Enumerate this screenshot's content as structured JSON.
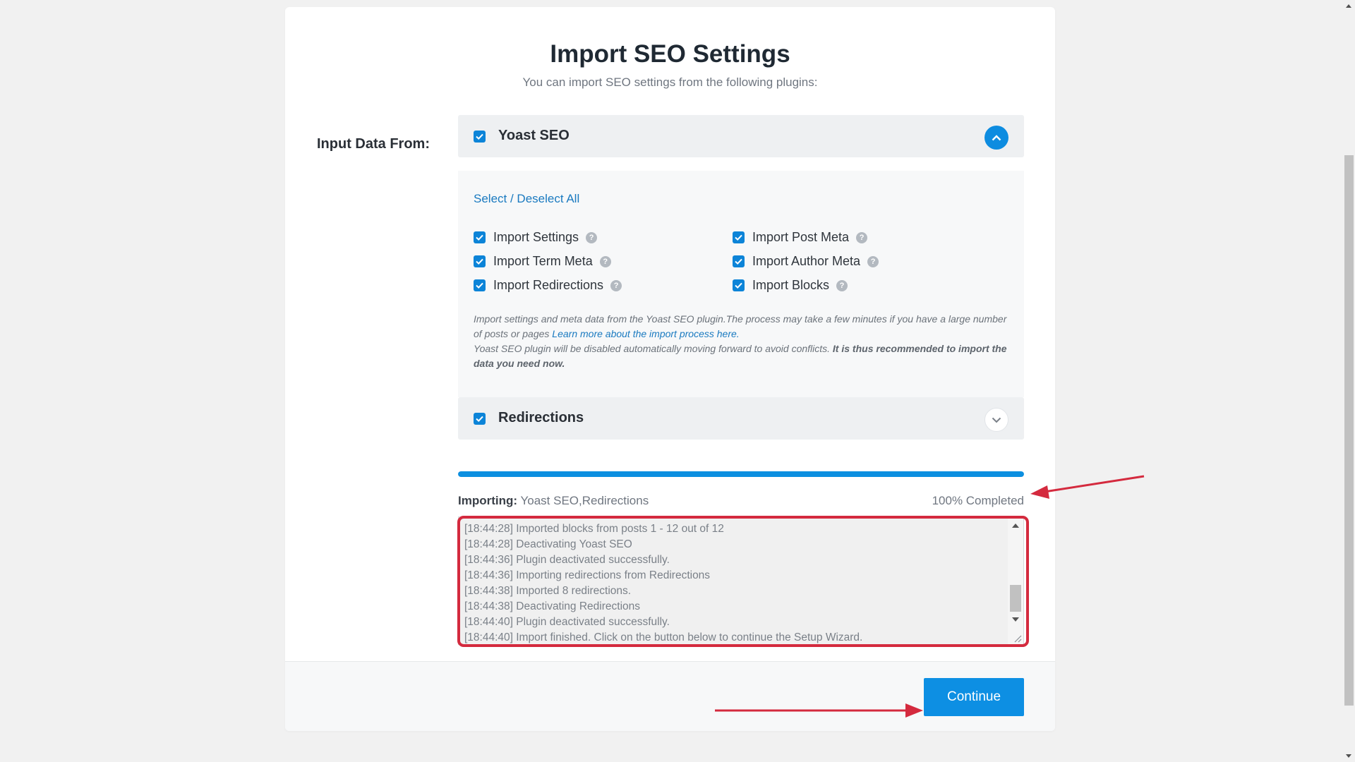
{
  "wizard": {
    "title": "Import SEO Settings",
    "subtitle": "You can import SEO settings from the following plugins:",
    "input_label": "Input Data From:"
  },
  "yoast_panel": {
    "title": "Yoast SEO",
    "checked": true,
    "expanded": true,
    "select_all": "Select / Deselect All",
    "options_left": [
      {
        "label": "Import Settings",
        "checked": true
      },
      {
        "label": "Import Term Meta",
        "checked": true
      },
      {
        "label": "Import Redirections",
        "checked": true
      }
    ],
    "options_right": [
      {
        "label": "Import Post Meta",
        "checked": true
      },
      {
        "label": "Import Author Meta",
        "checked": true
      },
      {
        "label": "Import Blocks",
        "checked": true
      }
    ],
    "help_glyph": "?",
    "description": {
      "text1": "Import settings and meta data from the Yoast SEO plugin.The process may take a few minutes if you have a large number of posts or pages ",
      "link": "Learn more about the import process here.",
      "text2": "Yoast SEO plugin will be disabled automatically moving forward to avoid conflicts. ",
      "bold": "It is thus recommended to import the data you need now."
    }
  },
  "redirections_panel": {
    "title": "Redirections",
    "checked": true,
    "expanded": false
  },
  "progress": {
    "percent": 100,
    "status_label": "Importing:",
    "status_value": "Yoast SEO,Redirections",
    "completed_text": "100% Completed"
  },
  "log": {
    "lines": [
      "[18:44:28] Imported blocks from posts 1 - 12 out of 12",
      "[18:44:28] Deactivating Yoast SEO",
      "[18:44:36] Plugin deactivated successfully.",
      "[18:44:36] Importing redirections from Redirections",
      "[18:44:38] Imported 8 redirections.",
      "[18:44:38] Deactivating Redirections",
      "[18:44:40] Plugin deactivated successfully.",
      "[18:44:40] Import finished. Click on the button below to continue the Setup Wizard."
    ]
  },
  "footer": {
    "continue_label": "Continue"
  },
  "colors": {
    "accent": "#0d8fe3",
    "annotation": "#d42a3e",
    "background": "#f1f1f1"
  }
}
